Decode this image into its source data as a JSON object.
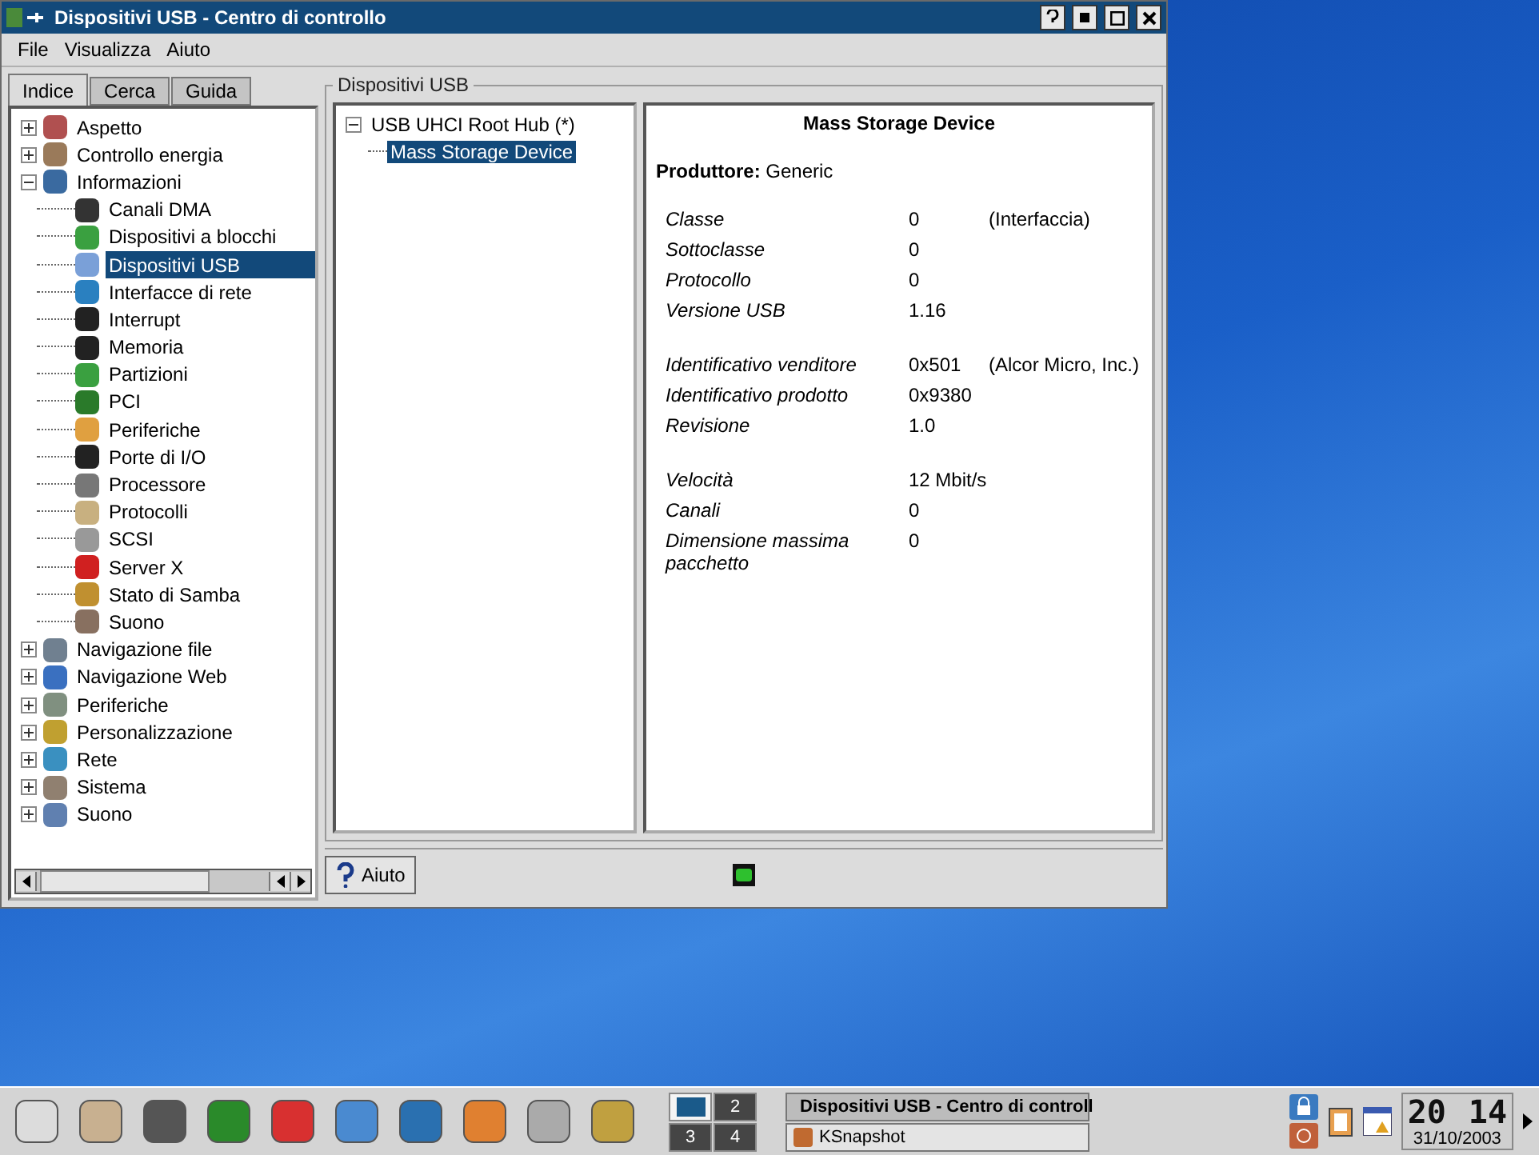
{
  "window": {
    "title": "Dispositivi USB - Centro di controllo"
  },
  "menu": [
    "File",
    "Visualizza",
    "Aiuto"
  ],
  "tabs": [
    {
      "label": "Indice",
      "selected": true
    },
    {
      "label": "Cerca",
      "selected": false
    },
    {
      "label": "Guida",
      "selected": false
    }
  ],
  "tree": [
    {
      "label": "Aspetto",
      "expanded": false
    },
    {
      "label": "Controllo energia",
      "expanded": false
    },
    {
      "label": "Informazioni",
      "expanded": true,
      "children": [
        {
          "label": "Canali DMA",
          "selected": false
        },
        {
          "label": "Dispositivi a blocchi",
          "selected": false
        },
        {
          "label": "Dispositivi USB",
          "selected": true
        },
        {
          "label": "Interfacce di rete",
          "selected": false
        },
        {
          "label": "Interrupt",
          "selected": false
        },
        {
          "label": "Memoria",
          "selected": false
        },
        {
          "label": "Partizioni",
          "selected": false
        },
        {
          "label": "PCI",
          "selected": false
        },
        {
          "label": "Periferiche",
          "selected": false
        },
        {
          "label": "Porte di I/O",
          "selected": false
        },
        {
          "label": "Processore",
          "selected": false
        },
        {
          "label": "Protocolli",
          "selected": false
        },
        {
          "label": "SCSI",
          "selected": false
        },
        {
          "label": "Server X",
          "selected": false
        },
        {
          "label": "Stato di Samba",
          "selected": false
        },
        {
          "label": "Suono",
          "selected": false
        }
      ]
    },
    {
      "label": "Navigazione file",
      "expanded": false
    },
    {
      "label": "Navigazione Web",
      "expanded": false
    },
    {
      "label": "Periferiche",
      "expanded": false
    },
    {
      "label": "Personalizzazione",
      "expanded": false
    },
    {
      "label": "Rete",
      "expanded": false
    },
    {
      "label": "Sistema",
      "expanded": false
    },
    {
      "label": "Suono",
      "expanded": false
    }
  ],
  "group_title": "Dispositivi USB",
  "devices": [
    {
      "label": "USB UHCI Root Hub (*)",
      "expanded": true,
      "children": [
        {
          "label": "Mass Storage Device",
          "selected": true
        }
      ]
    }
  ],
  "detail": {
    "title": "Mass Storage Device",
    "manufacturer": "**Produttore:** Generic",
    "groups": [
      [
        {
          "label": "Classe",
          "value": "0",
          "note": "(Interfaccia)"
        },
        {
          "label": "Sottoclasse",
          "value": "0"
        },
        {
          "label": "Protocollo",
          "value": "0"
        },
        {
          "label": "Versione USB",
          "value": "1.16"
        }
      ],
      [
        {
          "label": "Identificativo venditore",
          "value": "0x501",
          "note": "(Alcor Micro, Inc.)"
        },
        {
          "label": "Identificativo prodotto",
          "value": "0x9380"
        },
        {
          "label": "Revisione",
          "value": "1.0"
        }
      ],
      [
        {
          "label": "Velocità",
          "value": "12 Mbit/s"
        },
        {
          "label": "Canali",
          "value": "0"
        },
        {
          "label": "Dimensione massima pacchetto",
          "value": "0"
        }
      ]
    ]
  },
  "help_button": "Aiuto",
  "taskbar": {
    "desktops": [
      {
        "selected": true
      },
      {
        "label": "2",
        "selected": false
      },
      {
        "label": "3",
        "selected": false
      },
      {
        "label": "4",
        "selected": false
      }
    ],
    "tasks": [
      {
        "title": "Dispositivi USB - Centro di controll",
        "selected": true
      },
      {
        "title": "KSnapshot",
        "selected": false
      }
    ],
    "clock": {
      "hours": "20",
      "minutes": "14",
      "date": "31/10/2003"
    }
  }
}
